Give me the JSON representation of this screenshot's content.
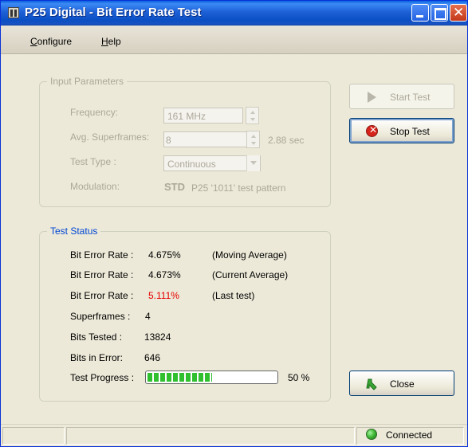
{
  "window": {
    "title": "P25 Digital - Bit Error Rate Test"
  },
  "menu": {
    "configure": "onfigure",
    "configure_accel": "C",
    "help": "elp",
    "help_accel": "H"
  },
  "input_params": {
    "group_title": "Input Parameters",
    "frequency_label": "Frequency:",
    "frequency_value": "161 MHz",
    "superframes_label": "Avg. Superframes:",
    "superframes_value": "8",
    "superframes_duration": "2.88 sec",
    "test_type_label": "Test Type :",
    "test_type_value": "Continuous",
    "modulation_label": "Modulation:",
    "modulation_std": "STD",
    "modulation_desc": "P25  '1011' test pattern"
  },
  "test_status": {
    "group_title": "Test Status",
    "ber_label": "Bit Error Rate :",
    "ber_moving_value": "4.675%",
    "ber_moving_note": "(Moving Average)",
    "ber_current_value": "4.673%",
    "ber_current_note": "(Current Average)",
    "ber_last_value": "5.111%",
    "ber_last_note": "(Last test)",
    "superframes_label": "Superframes  :",
    "superframes_value": "4",
    "bits_tested_label": "Bits Tested :",
    "bits_tested_value": "13824",
    "bits_error_label": "Bits in Error:",
    "bits_error_value": "646",
    "progress_label": "Test Progress :",
    "progress_percent_text": "50 %",
    "progress_fraction": 0.5
  },
  "buttons": {
    "start_test": "Start Test",
    "stop_test": "Stop Test",
    "close": "Close"
  },
  "statusbar": {
    "connection": "Connected"
  },
  "colors": {
    "title_bar": "#1f62d8",
    "last_test_value": "#e60000",
    "progress": "#2fbf2f",
    "connected_led": "#3fb534"
  }
}
